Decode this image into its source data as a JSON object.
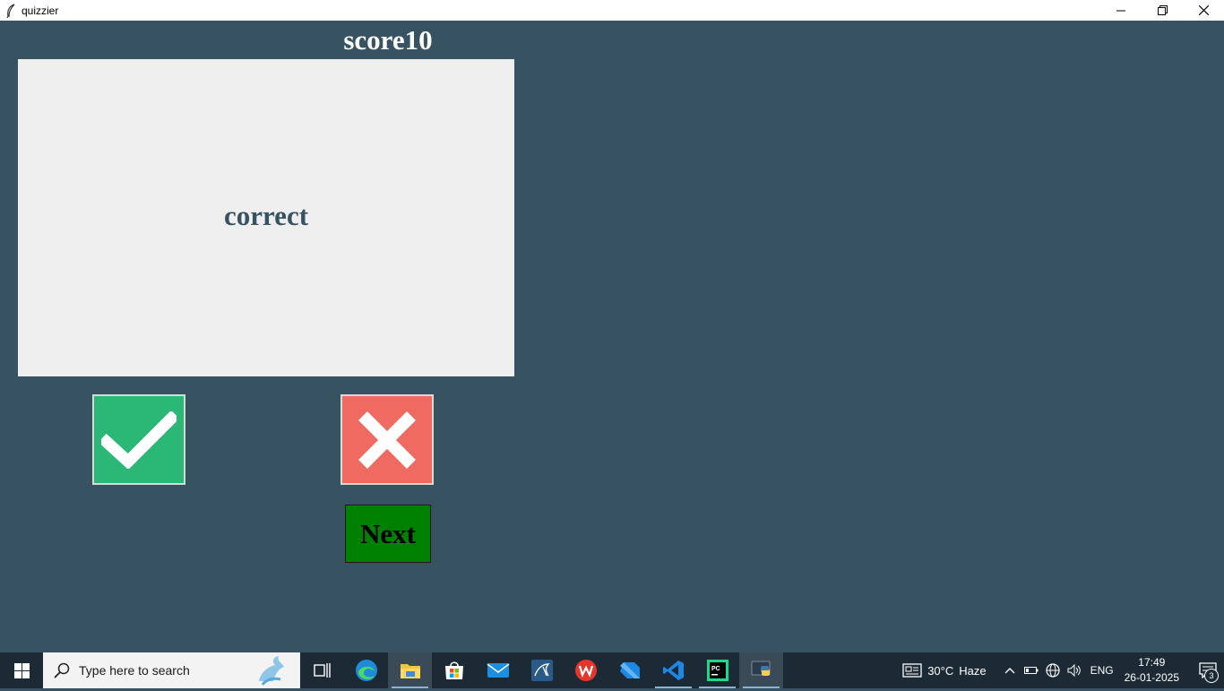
{
  "window": {
    "title": "quizzier"
  },
  "app": {
    "score_label": "score10",
    "card_text": "correct",
    "true_button_icon": "check-icon",
    "false_button_icon": "x-icon",
    "next_label": "Next"
  },
  "colors": {
    "background": "#375362",
    "card": "#efefef",
    "true_button": "#2bb877",
    "false_button": "#ef6b61",
    "next_button": "#008000"
  },
  "taskbar": {
    "search_placeholder": "Type here to search",
    "apps": [
      "task-view",
      "edge",
      "file-explorer",
      "microsoft-store",
      "mail",
      "mysql-workbench",
      "wps-office",
      "dart",
      "vscode",
      "pycharm",
      "python"
    ],
    "weather": {
      "temperature": "30°C",
      "condition": "Haze"
    },
    "language": "ENG",
    "time": "17:49",
    "date": "26-01-2025",
    "notification_count": "3"
  }
}
